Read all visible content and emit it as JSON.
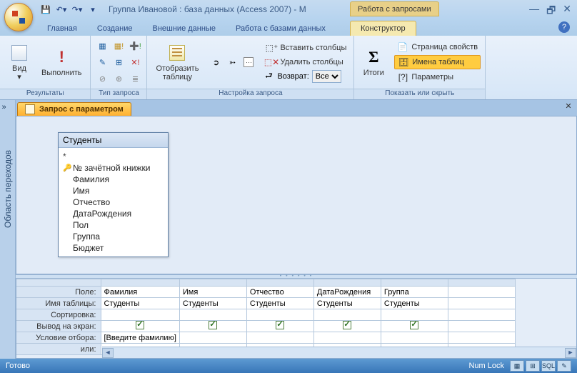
{
  "window": {
    "title": "Группа Ивановой : база данных (Access 2007) - M",
    "context_tab_group": "Работа с запросами",
    "status_ready": "Готово",
    "numlock": "Num Lock"
  },
  "tabs": {
    "home": "Главная",
    "create": "Создание",
    "external": "Внешние данные",
    "dbtools": "Работа с базами данных",
    "design": "Конструктор"
  },
  "ribbon": {
    "results_group": "Результаты",
    "view": "Вид",
    "run": "Выполнить",
    "query_type_group": "Тип запроса",
    "query_setup_group": "Настройка запроса",
    "show_table": "Отобразить\nтаблицу",
    "insert_cols": "Вставить столбцы",
    "delete_cols": "Удалить столбцы",
    "return_label": "Возврат:",
    "return_value": "Все",
    "totals": "Итоги",
    "show_hide_group": "Показать или скрыть",
    "property_sheet": "Страница свойств",
    "table_names": "Имена таблиц",
    "parameters": "Параметры"
  },
  "nav": {
    "title": "Область переходов"
  },
  "doc": {
    "tab_name": "Запрос с параметром"
  },
  "table": {
    "name": "Студенты",
    "fields": [
      "№ зачётной книжки",
      "Фамилия",
      "Имя",
      "Отчество",
      "ДатаРождения",
      "Пол",
      "Группа",
      "Бюджет"
    ]
  },
  "grid": {
    "labels": {
      "field": "Поле:",
      "table": "Имя таблицы:",
      "sort": "Сортировка:",
      "show": "Вывод на экран:",
      "criteria": "Условие отбора:",
      "or": "или:"
    },
    "columns": [
      {
        "field": "Фамилия",
        "table": "Студенты",
        "show": true,
        "criteria": "[Введите фамилию]"
      },
      {
        "field": "Имя",
        "table": "Студенты",
        "show": true,
        "criteria": ""
      },
      {
        "field": "Отчество",
        "table": "Студенты",
        "show": true,
        "criteria": ""
      },
      {
        "field": "ДатаРождения",
        "table": "Студенты",
        "show": true,
        "criteria": ""
      },
      {
        "field": "Группа",
        "table": "Студенты",
        "show": true,
        "criteria": ""
      }
    ]
  }
}
